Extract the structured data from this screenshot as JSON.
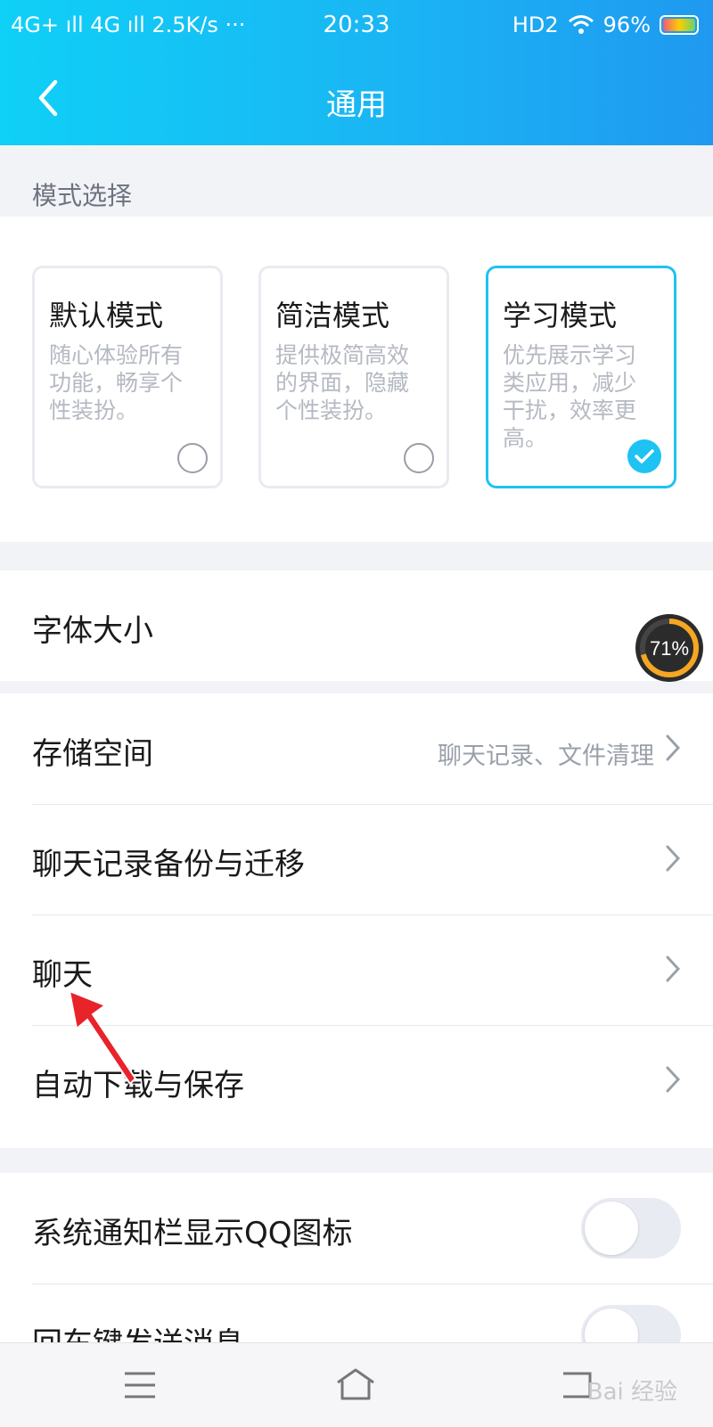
{
  "status_bar": {
    "left": "4G+ ıll 4G ıll 2.5K/s ···",
    "time": "20:33",
    "hd": "HD2",
    "battery": "96%"
  },
  "header": {
    "title": "通用"
  },
  "mode_section": {
    "label": "模式选择",
    "modes": [
      {
        "name": "默认模式",
        "desc": "随心体验所有功能，畅享个性装扮。",
        "selected": false
      },
      {
        "name": "简洁模式",
        "desc": "提供极简高效的界面，隐藏个性装扮。",
        "selected": false
      },
      {
        "name": "学习模式",
        "desc": "优先展示学习类应用，减少干扰，效率更高。",
        "selected": true
      }
    ]
  },
  "font_size": {
    "label": "字体大小",
    "gauge_text": "71%",
    "gauge_value": 0.71
  },
  "storage_group": {
    "items": [
      {
        "label": "存储空间",
        "sub": "聊天记录、文件清理"
      },
      {
        "label": "聊天记录备份与迁移",
        "sub": ""
      },
      {
        "label": "聊天",
        "sub": ""
      },
      {
        "label": "自动下载与保存",
        "sub": ""
      }
    ]
  },
  "toggle_group": {
    "items": [
      {
        "label": "系统通知栏显示QQ图标",
        "on": false
      },
      {
        "label": "回车键发送消息",
        "on": false
      }
    ]
  },
  "system_nav": {
    "watermark": "Bai 经验"
  },
  "colors": {
    "accent": "#1ec2f3",
    "arrow": "#e8232a"
  }
}
